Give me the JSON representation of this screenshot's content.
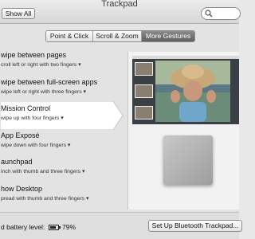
{
  "window": {
    "title": "Trackpad"
  },
  "toolbar": {
    "show_all_label": "Show All",
    "search_placeholder": ""
  },
  "tabs": [
    {
      "label": "Point & Click",
      "active": false
    },
    {
      "label": "Scroll & Zoom",
      "active": false
    },
    {
      "label": "More Gestures",
      "active": true
    }
  ],
  "gestures": [
    {
      "label": "wipe between pages",
      "sub": "croll left or right with two fingers"
    },
    {
      "label": "wipe between full-screen apps",
      "sub": "wipe left or right with three fingers"
    },
    {
      "label": "Mission Control",
      "sub": "wipe up with four fingers",
      "selected": true
    },
    {
      "label": "App Exposé",
      "sub": "wipe down with four fingers"
    },
    {
      "label": "aunchpad",
      "sub": "inch with thumb and three fingers"
    },
    {
      "label": "how Desktop",
      "sub": "pread with thumb and three fingers"
    }
  ],
  "footer": {
    "battery_label": "d battery level:",
    "battery_percent": "79%",
    "battery_level": 0.79,
    "setup_button": "Set Up Bluetooth Trackpad..."
  },
  "colors": {
    "selected_row": "#ffffff",
    "active_tab": "#6d6d6d"
  },
  "icons": [
    "search-icon",
    "dropdown-arrow-icon",
    "battery-icon"
  ]
}
